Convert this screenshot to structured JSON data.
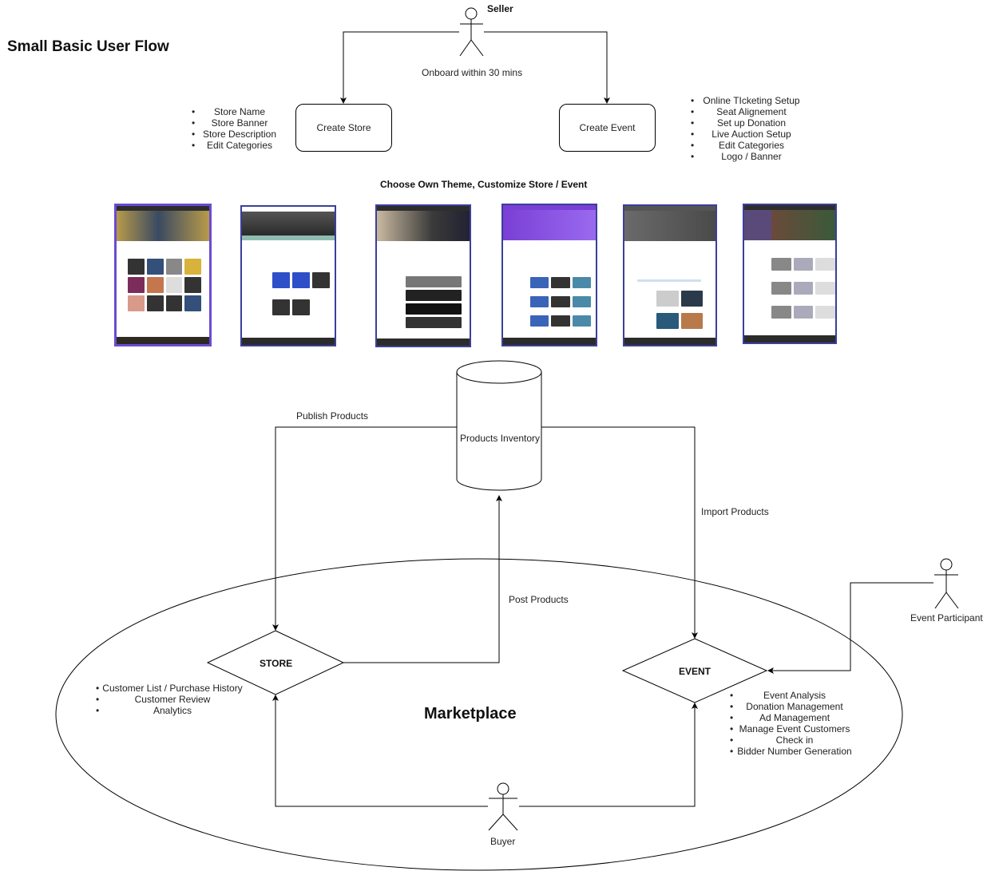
{
  "diagram": {
    "title": "Small Basic User Flow",
    "actors": {
      "seller": "Seller",
      "buyer": "Buyer",
      "event_participant": "Event Participant"
    },
    "onboard_label": "Onboard within 30 mins",
    "create_store": {
      "label": "Create Store",
      "features": [
        "Store Name",
        "Store Banner",
        "Store Description",
        "Edit Categories"
      ]
    },
    "create_event": {
      "label": "Create Event",
      "features": [
        "Online TIcketing Setup",
        "Seat Alignement",
        "Set up Donation",
        "Live Auction Setup",
        "Edit Categories",
        "Logo / Banner"
      ]
    },
    "theme_heading": "Choose Own Theme, Customize Store / Event",
    "themes": [
      {
        "name": "theme-johny-garments",
        "accent": "#6a4bd1"
      },
      {
        "name": "theme-sneakers-store",
        "accent": "#8fbcb0"
      },
      {
        "name": "theme-headphones-store",
        "accent": "#5aa9e6"
      },
      {
        "name": "theme-purple-sneakers",
        "accent": "#8a4fe0"
      },
      {
        "name": "theme-bicycle-event",
        "accent": "#5a5a5a"
      },
      {
        "name": "theme-gamepad-store",
        "accent": "#444444"
      }
    ],
    "inventory_label": "Products Inventory",
    "edge_labels": {
      "publish": "Publish Products",
      "import": "Import Products",
      "post": "Post Products"
    },
    "marketplace_label": "Marketplace",
    "store_node": {
      "label": "STORE",
      "features": [
        "Customer List / Purchase History",
        "Customer Review",
        "Analytics"
      ]
    },
    "event_node": {
      "label": "EVENT",
      "features": [
        "Event Analysis",
        "Donation Management",
        "Ad Management",
        "Manage Event Customers",
        "Check in",
        "Bidder Number Generation"
      ]
    }
  }
}
